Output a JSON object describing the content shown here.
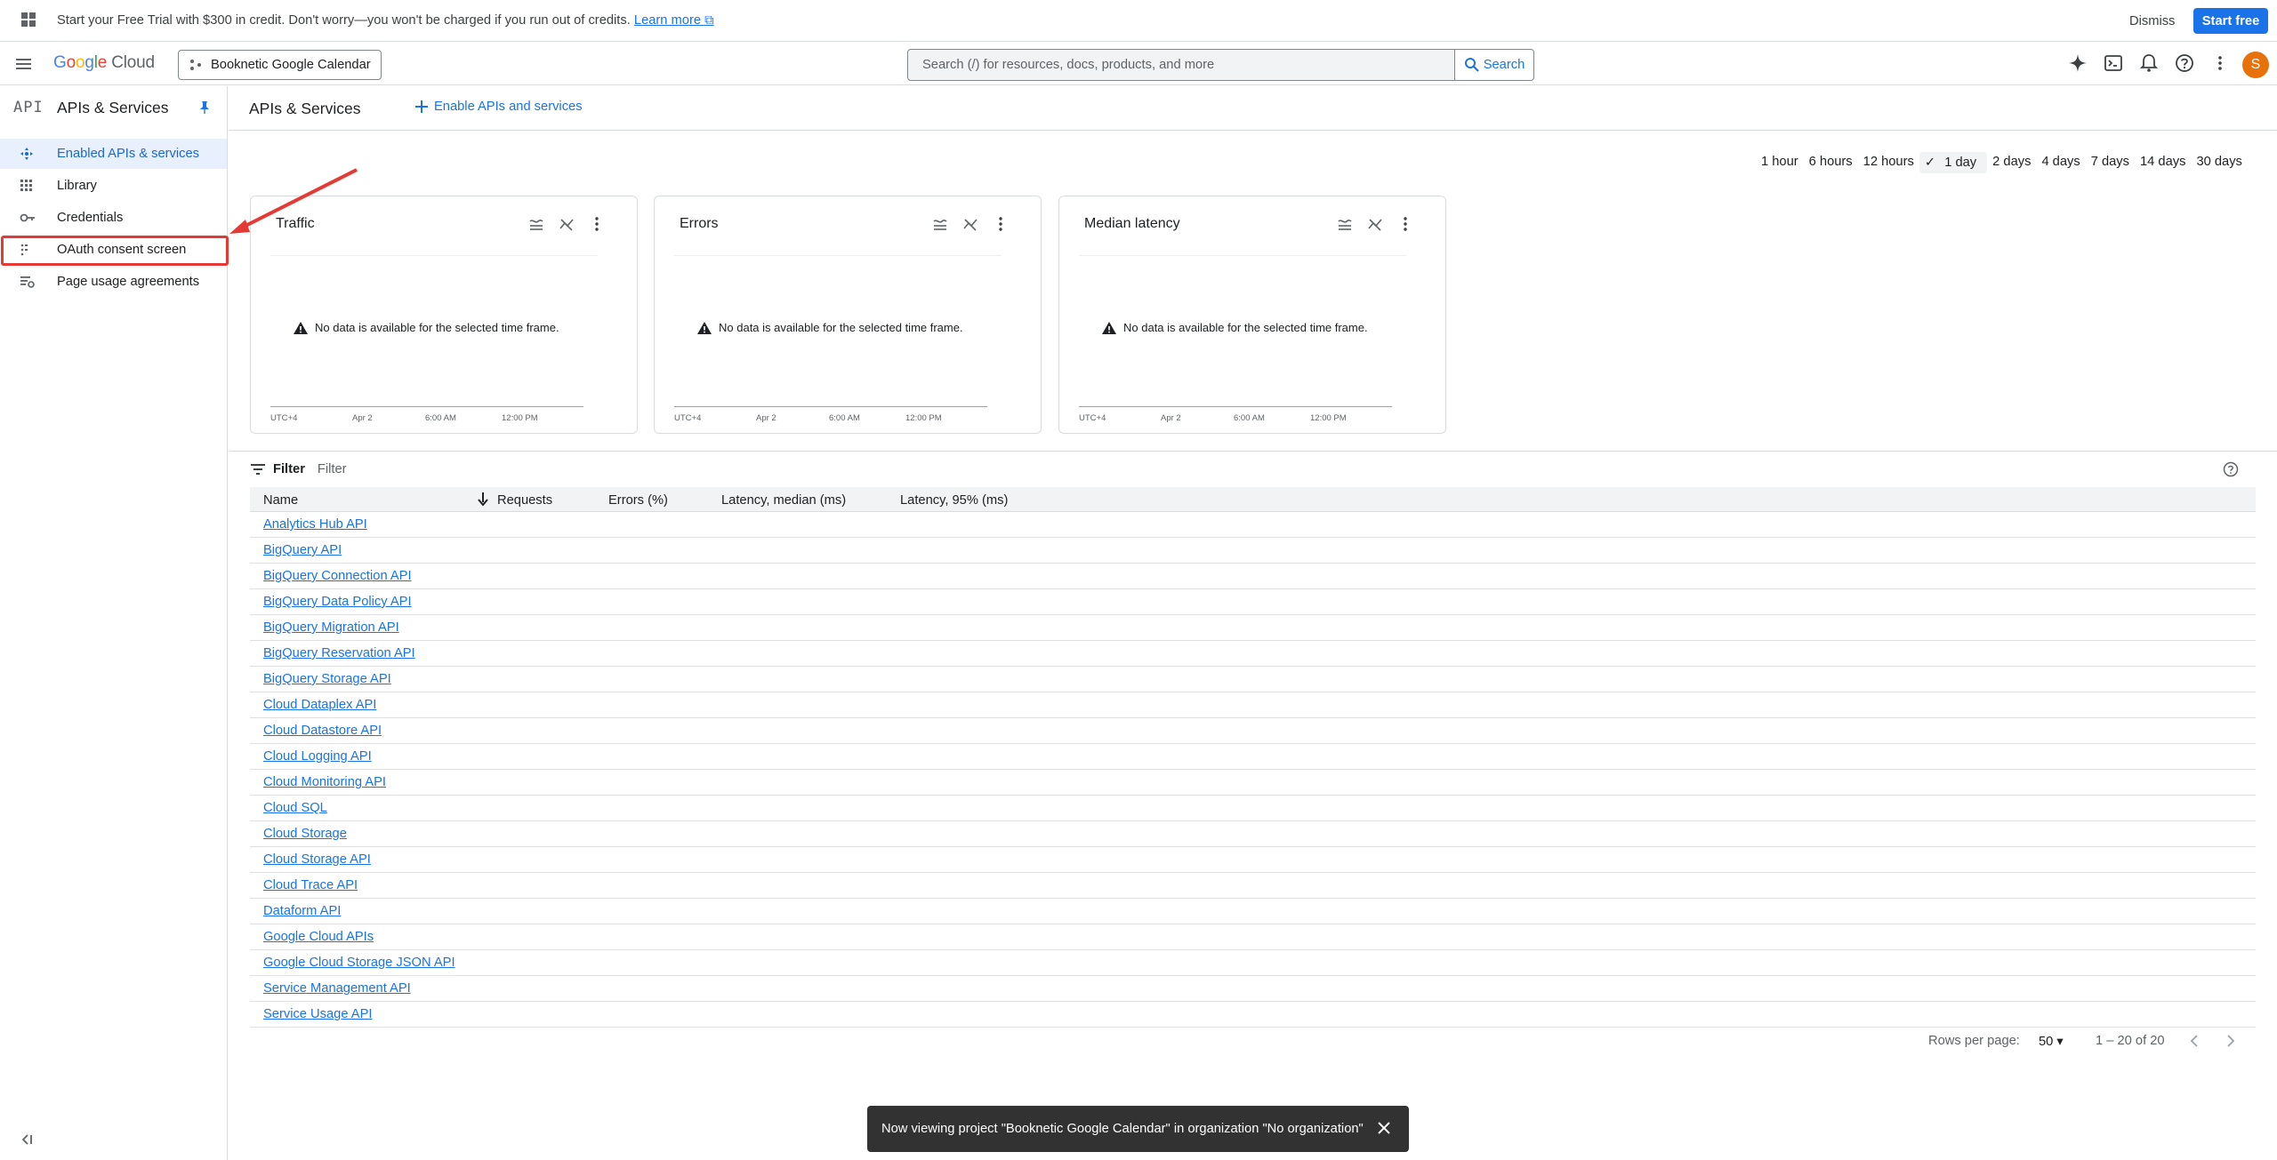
{
  "banner": {
    "message": "Start your Free Trial with $300 in credit. Don't worry—you won't be charged if you run out of credits.",
    "learn_more": "Learn more",
    "dismiss": "Dismiss",
    "start_free": "Start free"
  },
  "header": {
    "logo_google": "Google",
    "logo_cloud": "Cloud",
    "project": "Booknetic Google Calendar",
    "search_placeholder": "Search (/) for resources, docs, products, and more",
    "search_button": "Search",
    "avatar_letter": "S"
  },
  "sidebar": {
    "api_logo": "API",
    "title": "APIs & Services",
    "items": [
      {
        "label": "Enabled APIs & services",
        "icon": "dashboard-icon"
      },
      {
        "label": "Library",
        "icon": "library-icon"
      },
      {
        "label": "Credentials",
        "icon": "key-icon"
      },
      {
        "label": "OAuth consent screen",
        "icon": "consent-icon"
      },
      {
        "label": "Page usage agreements",
        "icon": "agreements-icon"
      }
    ]
  },
  "main": {
    "title": "APIs & Services",
    "enable_button": "Enable APIs and services",
    "time_ranges": [
      "1 hour",
      "6 hours",
      "12 hours",
      "1 day",
      "2 days",
      "4 days",
      "7 days",
      "14 days",
      "30 days"
    ],
    "selected_range": "1 day",
    "cards": [
      {
        "title": "Traffic",
        "no_data": "No data is available for the selected time frame.",
        "ticks": [
          "UTC+4",
          "Apr 2",
          "6:00 AM",
          "12:00 PM"
        ]
      },
      {
        "title": "Errors",
        "no_data": "No data is available for the selected time frame.",
        "ticks": [
          "UTC+4",
          "Apr 2",
          "6:00 AM",
          "12:00 PM"
        ]
      },
      {
        "title": "Median latency",
        "no_data": "No data is available for the selected time frame.",
        "ticks": [
          "UTC+4",
          "Apr 2",
          "6:00 AM",
          "12:00 PM"
        ]
      }
    ],
    "filter_label": "Filter",
    "filter_placeholder": "Filter",
    "columns": [
      "Name",
      "Requests",
      "Errors (%)",
      "Latency, median (ms)",
      "Latency, 95% (ms)"
    ],
    "rows": [
      "Analytics Hub API",
      "BigQuery API",
      "BigQuery Connection API",
      "BigQuery Data Policy API",
      "BigQuery Migration API",
      "BigQuery Reservation API",
      "BigQuery Storage API",
      "Cloud Dataplex API",
      "Cloud Datastore API",
      "Cloud Logging API",
      "Cloud Monitoring API",
      "Cloud SQL",
      "Cloud Storage",
      "Cloud Storage API",
      "Cloud Trace API",
      "Dataform API",
      "Google Cloud APIs",
      "Google Cloud Storage JSON API",
      "Service Management API",
      "Service Usage API"
    ],
    "pager": {
      "rows_per_page_label": "Rows per page:",
      "rows_per_page": "50",
      "range": "1 – 20 of 20"
    }
  },
  "toast": {
    "message": "Now viewing project \"Booknetic Google Calendar\" in organization \"No organization\""
  },
  "colors": {
    "accent": "#1a73e8",
    "highlight": "#e53935",
    "active_bg": "#e8f0fe"
  }
}
